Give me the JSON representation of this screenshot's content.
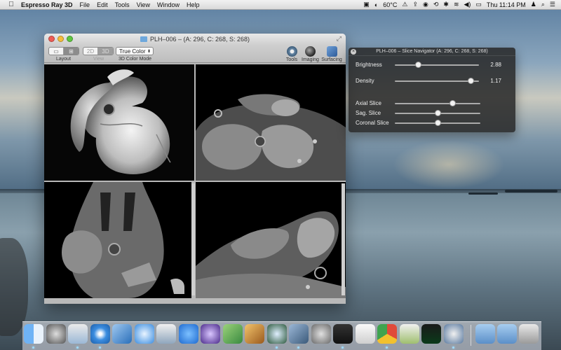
{
  "menubar": {
    "app_name": "Espresso Ray 3D",
    "menus": [
      "File",
      "Edit",
      "Tools",
      "View",
      "Window",
      "Help"
    ],
    "temperature": "60°C",
    "clock": "Thu 11:14 PM"
  },
  "main_window": {
    "title": "PLH–006 – (A: 296, C: 268, S: 268)",
    "toolbar": {
      "layout_label": "Layout",
      "view_label": "View",
      "view_2d": "2D",
      "view_3d": "3D",
      "color_mode_value": "True Color",
      "color_mode_label": "3D Color Mode",
      "tools_label": "Tools",
      "imaging_label": "Imaging",
      "surfacing_label": "Surfacing"
    }
  },
  "slice_navigator": {
    "title": "PLH–006 – Slice Navigator (A: 296, C: 268, S: 268)",
    "brightness": {
      "label": "Brightness",
      "value": "2.88",
      "fraction": 0.28
    },
    "density": {
      "label": "Density",
      "value": "1.17",
      "fraction": 0.9
    },
    "axial": {
      "label": "Axial Slice",
      "fraction": 0.68
    },
    "sagittal": {
      "label": "Sag. Slice",
      "fraction": 0.5
    },
    "coronal": {
      "label": "Coronal Slice",
      "fraction": 0.5
    }
  },
  "dock": {
    "icons": [
      "finder-icon",
      "launchpad-icon",
      "mail-icon",
      "safari-icon",
      "xcode-icon",
      "itunes-icon",
      "preview-icon",
      "app-store-icon",
      "imovie-icon",
      "iphoto-icon",
      "garageband-icon",
      "time-machine-icon",
      "vmware-icon",
      "system-preferences-icon",
      "terminal-icon",
      "textedit-icon",
      "chrome-icon",
      "keychain-icon",
      "activity-monitor-icon",
      "espresso-ray-icon"
    ],
    "stack_icons": [
      "applications-folder-icon",
      "documents-folder-icon",
      "trash-icon"
    ]
  }
}
